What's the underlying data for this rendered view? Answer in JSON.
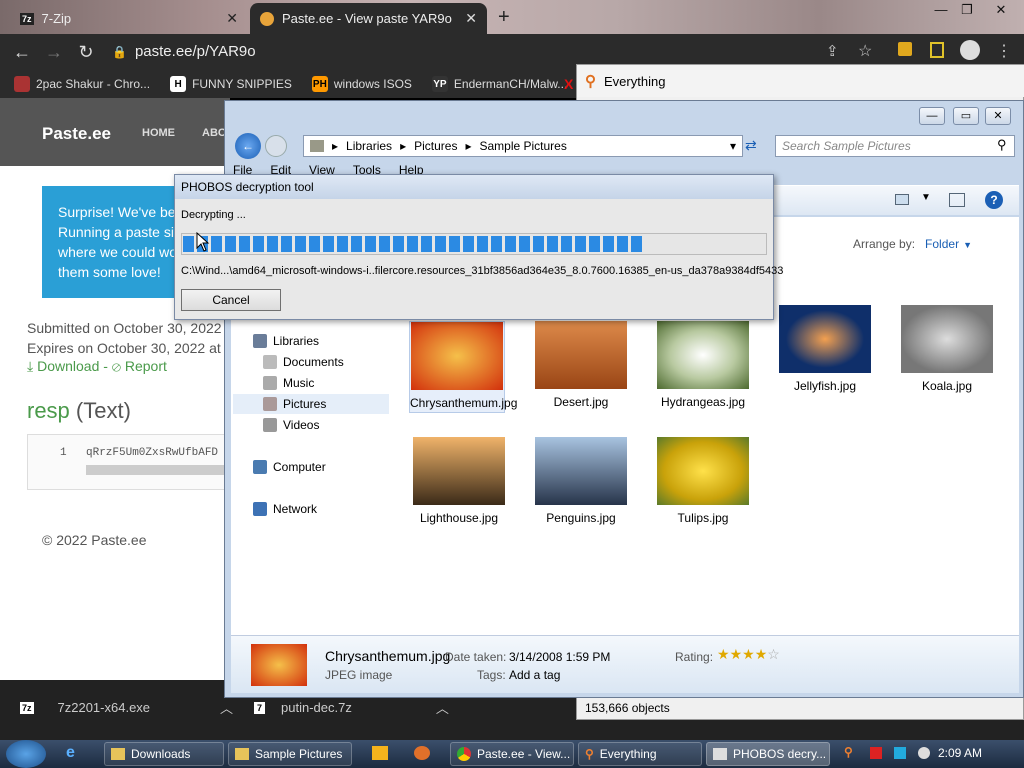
{
  "browser": {
    "tabs": [
      {
        "label": "7-Zip",
        "icon": "7zip-icon"
      },
      {
        "label": "Paste.ee - View paste YAR9o",
        "icon": "pasteee-icon"
      }
    ],
    "url": "paste.ee/p/YAR9o",
    "bookmarks": [
      {
        "label": "2pac Shakur - Chro...",
        "icon": "2pac-icon"
      },
      {
        "label": "FUNNY SNIPPIES",
        "icon": "h-icon",
        "badge": "H"
      },
      {
        "label": "windows ISOS",
        "icon": "ph-icon",
        "badge": "PH"
      },
      {
        "label": "EndermanCH/Malw...",
        "icon": "yp-icon",
        "badge": "YP"
      }
    ]
  },
  "webpage": {
    "brand": "Paste.ee",
    "nav_home": "HOME",
    "nav_about": "ABO",
    "alert_lines": [
      "Surprise! We've bee",
      "Running a paste sit",
      "where we could wo",
      "them some love!"
    ],
    "submitted": "Submitted on October 30, 2022",
    "expires": "Expires on October 30, 2022 at",
    "download": "Download",
    "separator": "-",
    "report": "Report",
    "resp_name": "resp",
    "resp_type": "(Text)",
    "line_no": "1",
    "code": "qRrzF5Um0ZxsRwUfbAFD",
    "copyright": "© 2022 Paste.ee"
  },
  "downloads": [
    {
      "label": "7z2201-x64.exe"
    },
    {
      "label": "putin-dec.7z"
    }
  ],
  "everything": {
    "title": "Everything",
    "status": "153,666 objects"
  },
  "explorer": {
    "breadcrumb": [
      "Libraries",
      "Pictures",
      "Sample Pictures"
    ],
    "search_placeholder": "Search Sample Pictures",
    "menu": [
      "File",
      "Edit",
      "View",
      "Tools",
      "Help"
    ],
    "arrange_label": "Arrange by:",
    "arrange_value": "Folder",
    "nav": [
      {
        "label": "Libraries"
      },
      {
        "label": "Documents"
      },
      {
        "label": "Music"
      },
      {
        "label": "Pictures"
      },
      {
        "label": "Videos"
      },
      {
        "label": "Computer"
      },
      {
        "label": "Network"
      }
    ],
    "files": [
      {
        "name": "Chrysanthemum.jpg",
        "color": "#e2400f"
      },
      {
        "name": "Desert.jpg",
        "color": "#b25a23"
      },
      {
        "name": "Hydrangeas.jpg",
        "color": "#8fa86e"
      },
      {
        "name": "Jellyfish.jpg",
        "color": "#1d3f7c"
      },
      {
        "name": "Koala.jpg",
        "color": "#8a8a80"
      },
      {
        "name": "Lighthouse.jpg",
        "color": "#6a5a3c"
      },
      {
        "name": "Penguins.jpg",
        "color": "#6f8fb3"
      },
      {
        "name": "Tulips.jpg",
        "color": "#e7c112"
      }
    ],
    "details": {
      "name": "Chrysanthemum.jpg",
      "type": "JPEG image",
      "date_label": "Date taken:",
      "date_value": "3/14/2008 1:59 PM",
      "tags_label": "Tags:",
      "tags_value": "Add a tag",
      "rating_label": "Rating:"
    }
  },
  "dialog": {
    "title": "PHOBOS decryption tool",
    "status": "Decrypting ...",
    "progress": 0.79,
    "path": "C:\\Wind...\\amd64_microsoft-windows-i..filercore.resources_31bf3856ad364e35_8.0.7600.16385_en-us_da378a9384df5433",
    "cancel": "Cancel"
  },
  "taskbar": {
    "items": [
      {
        "label": "Downloads"
      },
      {
        "label": "Sample Pictures"
      },
      {
        "label": "Paste.ee - View..."
      },
      {
        "label": "Everything"
      },
      {
        "label": "PHOBOS decry..."
      }
    ],
    "clock": "2:09 AM"
  }
}
